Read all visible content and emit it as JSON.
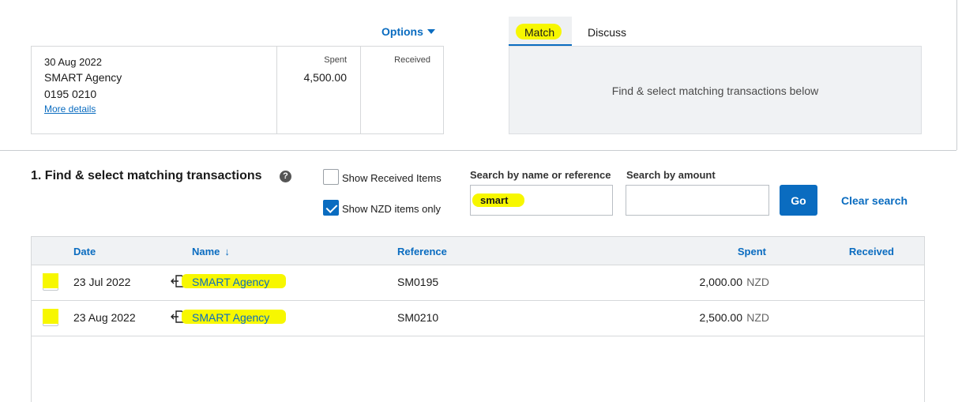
{
  "options": {
    "label": "Options"
  },
  "statement": {
    "date": "30 Aug 2022",
    "name": "SMART Agency",
    "account": "0195 0210",
    "more_details": "More details",
    "spent_label": "Spent",
    "spent_value": "4,500.00",
    "received_label": "Received"
  },
  "tabs": [
    {
      "label": "Match",
      "active": true
    },
    {
      "label": "Discuss",
      "active": false
    }
  ],
  "match_panel": {
    "message": "Find & select matching transactions below"
  },
  "find": {
    "title": "1. Find & select matching transactions",
    "help_icon": "question-circle-icon",
    "show_received": {
      "label": "Show Received Items",
      "checked": false
    },
    "show_nzd": {
      "label": "Show NZD items only",
      "checked": true
    },
    "search_name": {
      "label": "Search by name or reference",
      "value": "smart"
    },
    "search_amount": {
      "label": "Search by amount",
      "value": ""
    },
    "go_label": "Go",
    "clear_label": "Clear search"
  },
  "table": {
    "headers": {
      "date": "Date",
      "name": "Name",
      "sort_arrow": "↓",
      "reference": "Reference",
      "spent": "Spent",
      "received": "Received"
    },
    "rows": [
      {
        "date": "23 Jul 2022",
        "name": "SMART Agency",
        "reference": "SM0195",
        "spent": "2,000.00",
        "currency": "NZD"
      },
      {
        "date": "23 Aug 2022",
        "name": "SMART Agency",
        "reference": "SM0210",
        "spent": "2,500.00",
        "currency": "NZD"
      }
    ]
  },
  "colors": {
    "accent": "#0a6cc0",
    "highlight": "#f7f700"
  }
}
